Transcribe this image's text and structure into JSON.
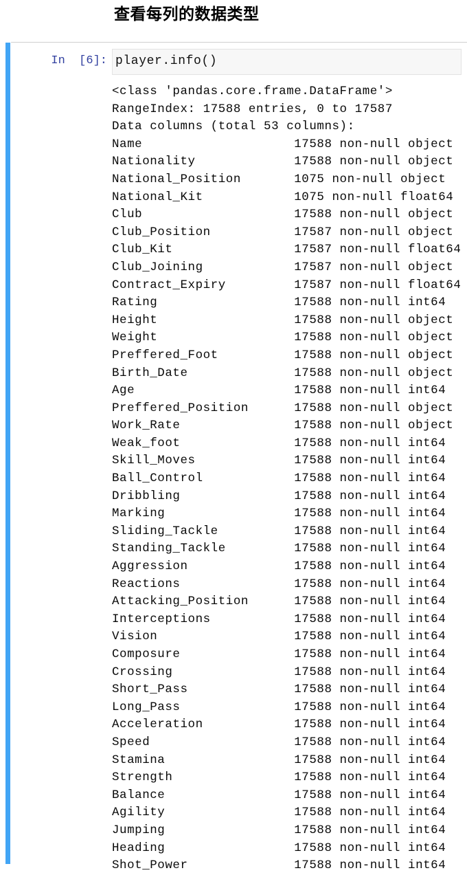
{
  "notebook": {
    "heading": "查看每列的数据类型",
    "cell": {
      "prompt_label": "In",
      "execution_count": "[6]",
      "prompt_colon": ":",
      "prompt_full": "In  [6]:",
      "input_code": "player.info()",
      "marker_color": "#42a5f5",
      "prompt_color": "#303F9F",
      "input_background": "#f7f7f7"
    },
    "output": {
      "header_lines": [
        "<class 'pandas.core.frame.DataFrame'>",
        "RangeIndex: 17588 entries, 0 to 17587",
        "Data columns (total 53 columns):"
      ],
      "column_name_width": 24,
      "columns": [
        {
          "name": "Name",
          "count": "17588",
          "nullity": "non-null",
          "dtype": "object"
        },
        {
          "name": "Nationality",
          "count": "17588",
          "nullity": "non-null",
          "dtype": "object"
        },
        {
          "name": "National_Position",
          "count": "1075",
          "nullity": "non-null",
          "dtype": "object"
        },
        {
          "name": "National_Kit",
          "count": "1075",
          "nullity": "non-null",
          "dtype": "float64"
        },
        {
          "name": "Club",
          "count": "17588",
          "nullity": "non-null",
          "dtype": "object"
        },
        {
          "name": "Club_Position",
          "count": "17587",
          "nullity": "non-null",
          "dtype": "object"
        },
        {
          "name": "Club_Kit",
          "count": "17587",
          "nullity": "non-null",
          "dtype": "float64"
        },
        {
          "name": "Club_Joining",
          "count": "17587",
          "nullity": "non-null",
          "dtype": "object"
        },
        {
          "name": "Contract_Expiry",
          "count": "17587",
          "nullity": "non-null",
          "dtype": "float64"
        },
        {
          "name": "Rating",
          "count": "17588",
          "nullity": "non-null",
          "dtype": "int64"
        },
        {
          "name": "Height",
          "count": "17588",
          "nullity": "non-null",
          "dtype": "object"
        },
        {
          "name": "Weight",
          "count": "17588",
          "nullity": "non-null",
          "dtype": "object"
        },
        {
          "name": "Preffered_Foot",
          "count": "17588",
          "nullity": "non-null",
          "dtype": "object"
        },
        {
          "name": "Birth_Date",
          "count": "17588",
          "nullity": "non-null",
          "dtype": "object"
        },
        {
          "name": "Age",
          "count": "17588",
          "nullity": "non-null",
          "dtype": "int64"
        },
        {
          "name": "Preffered_Position",
          "count": "17588",
          "nullity": "non-null",
          "dtype": "object"
        },
        {
          "name": "Work_Rate",
          "count": "17588",
          "nullity": "non-null",
          "dtype": "object"
        },
        {
          "name": "Weak_foot",
          "count": "17588",
          "nullity": "non-null",
          "dtype": "int64"
        },
        {
          "name": "Skill_Moves",
          "count": "17588",
          "nullity": "non-null",
          "dtype": "int64"
        },
        {
          "name": "Ball_Control",
          "count": "17588",
          "nullity": "non-null",
          "dtype": "int64"
        },
        {
          "name": "Dribbling",
          "count": "17588",
          "nullity": "non-null",
          "dtype": "int64"
        },
        {
          "name": "Marking",
          "count": "17588",
          "nullity": "non-null",
          "dtype": "int64"
        },
        {
          "name": "Sliding_Tackle",
          "count": "17588",
          "nullity": "non-null",
          "dtype": "int64"
        },
        {
          "name": "Standing_Tackle",
          "count": "17588",
          "nullity": "non-null",
          "dtype": "int64"
        },
        {
          "name": "Aggression",
          "count": "17588",
          "nullity": "non-null",
          "dtype": "int64"
        },
        {
          "name": "Reactions",
          "count": "17588",
          "nullity": "non-null",
          "dtype": "int64"
        },
        {
          "name": "Attacking_Position",
          "count": "17588",
          "nullity": "non-null",
          "dtype": "int64"
        },
        {
          "name": "Interceptions",
          "count": "17588",
          "nullity": "non-null",
          "dtype": "int64"
        },
        {
          "name": "Vision",
          "count": "17588",
          "nullity": "non-null",
          "dtype": "int64"
        },
        {
          "name": "Composure",
          "count": "17588",
          "nullity": "non-null",
          "dtype": "int64"
        },
        {
          "name": "Crossing",
          "count": "17588",
          "nullity": "non-null",
          "dtype": "int64"
        },
        {
          "name": "Short_Pass",
          "count": "17588",
          "nullity": "non-null",
          "dtype": "int64"
        },
        {
          "name": "Long_Pass",
          "count": "17588",
          "nullity": "non-null",
          "dtype": "int64"
        },
        {
          "name": "Acceleration",
          "count": "17588",
          "nullity": "non-null",
          "dtype": "int64"
        },
        {
          "name": "Speed",
          "count": "17588",
          "nullity": "non-null",
          "dtype": "int64"
        },
        {
          "name": "Stamina",
          "count": "17588",
          "nullity": "non-null",
          "dtype": "int64"
        },
        {
          "name": "Strength",
          "count": "17588",
          "nullity": "non-null",
          "dtype": "int64"
        },
        {
          "name": "Balance",
          "count": "17588",
          "nullity": "non-null",
          "dtype": "int64"
        },
        {
          "name": "Agility",
          "count": "17588",
          "nullity": "non-null",
          "dtype": "int64"
        },
        {
          "name": "Jumping",
          "count": "17588",
          "nullity": "non-null",
          "dtype": "int64"
        },
        {
          "name": "Heading",
          "count": "17588",
          "nullity": "non-null",
          "dtype": "int64"
        },
        {
          "name": "Shot_Power",
          "count": "17588",
          "nullity": "non-null",
          "dtype": "int64"
        }
      ]
    }
  }
}
